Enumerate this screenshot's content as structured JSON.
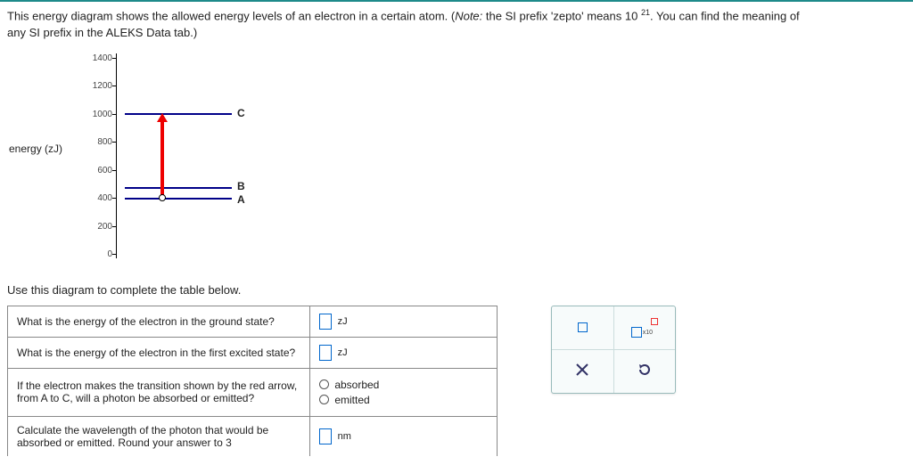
{
  "question": {
    "line1_a": "This energy diagram shows the allowed energy levels of an electron in a certain atom. (",
    "note_label": "Note:",
    "line1_b": " the SI prefix 'zepto' means 10 ",
    "exponent": "21",
    "line1_c": ". You can find the meaning of",
    "line2": "any SI prefix in the ALEKS Data tab.)"
  },
  "chart_data": {
    "type": "diagram",
    "ylabel": "energy (zJ)",
    "ylim": [
      0,
      1400
    ],
    "ticks": [
      0,
      200,
      400,
      600,
      800,
      1000,
      1200,
      1400
    ],
    "levels": [
      {
        "name": "A",
        "value": 400
      },
      {
        "name": "B",
        "value": 475
      },
      {
        "name": "C",
        "value": 1000
      }
    ],
    "transition": {
      "from": "A",
      "to": "C",
      "color": "red"
    }
  },
  "diagram": {
    "label_A": "A",
    "label_B": "B",
    "label_C": "C",
    "t0": "0",
    "t200": "200",
    "t400": "400",
    "t600": "600",
    "t800": "800",
    "t1000": "1000",
    "t1200": "1200",
    "t1400": "1400"
  },
  "instruction": "Use this diagram to complete the table below.",
  "table": {
    "q1": "What is the energy of the electron in the ground state?",
    "u1": "zJ",
    "q2": "What is the energy of the electron in the first excited state?",
    "u2": "zJ",
    "q3": "If the electron makes the transition shown by the red arrow, from A to C, will a photon be absorbed or emitted?",
    "opt_absorbed": "absorbed",
    "opt_emitted": "emitted",
    "q4": "Calculate the wavelength of the photon that would be absorbed or emitted. Round your answer to 3",
    "u4": "nm"
  },
  "tools": {
    "x10_label": "x10"
  }
}
